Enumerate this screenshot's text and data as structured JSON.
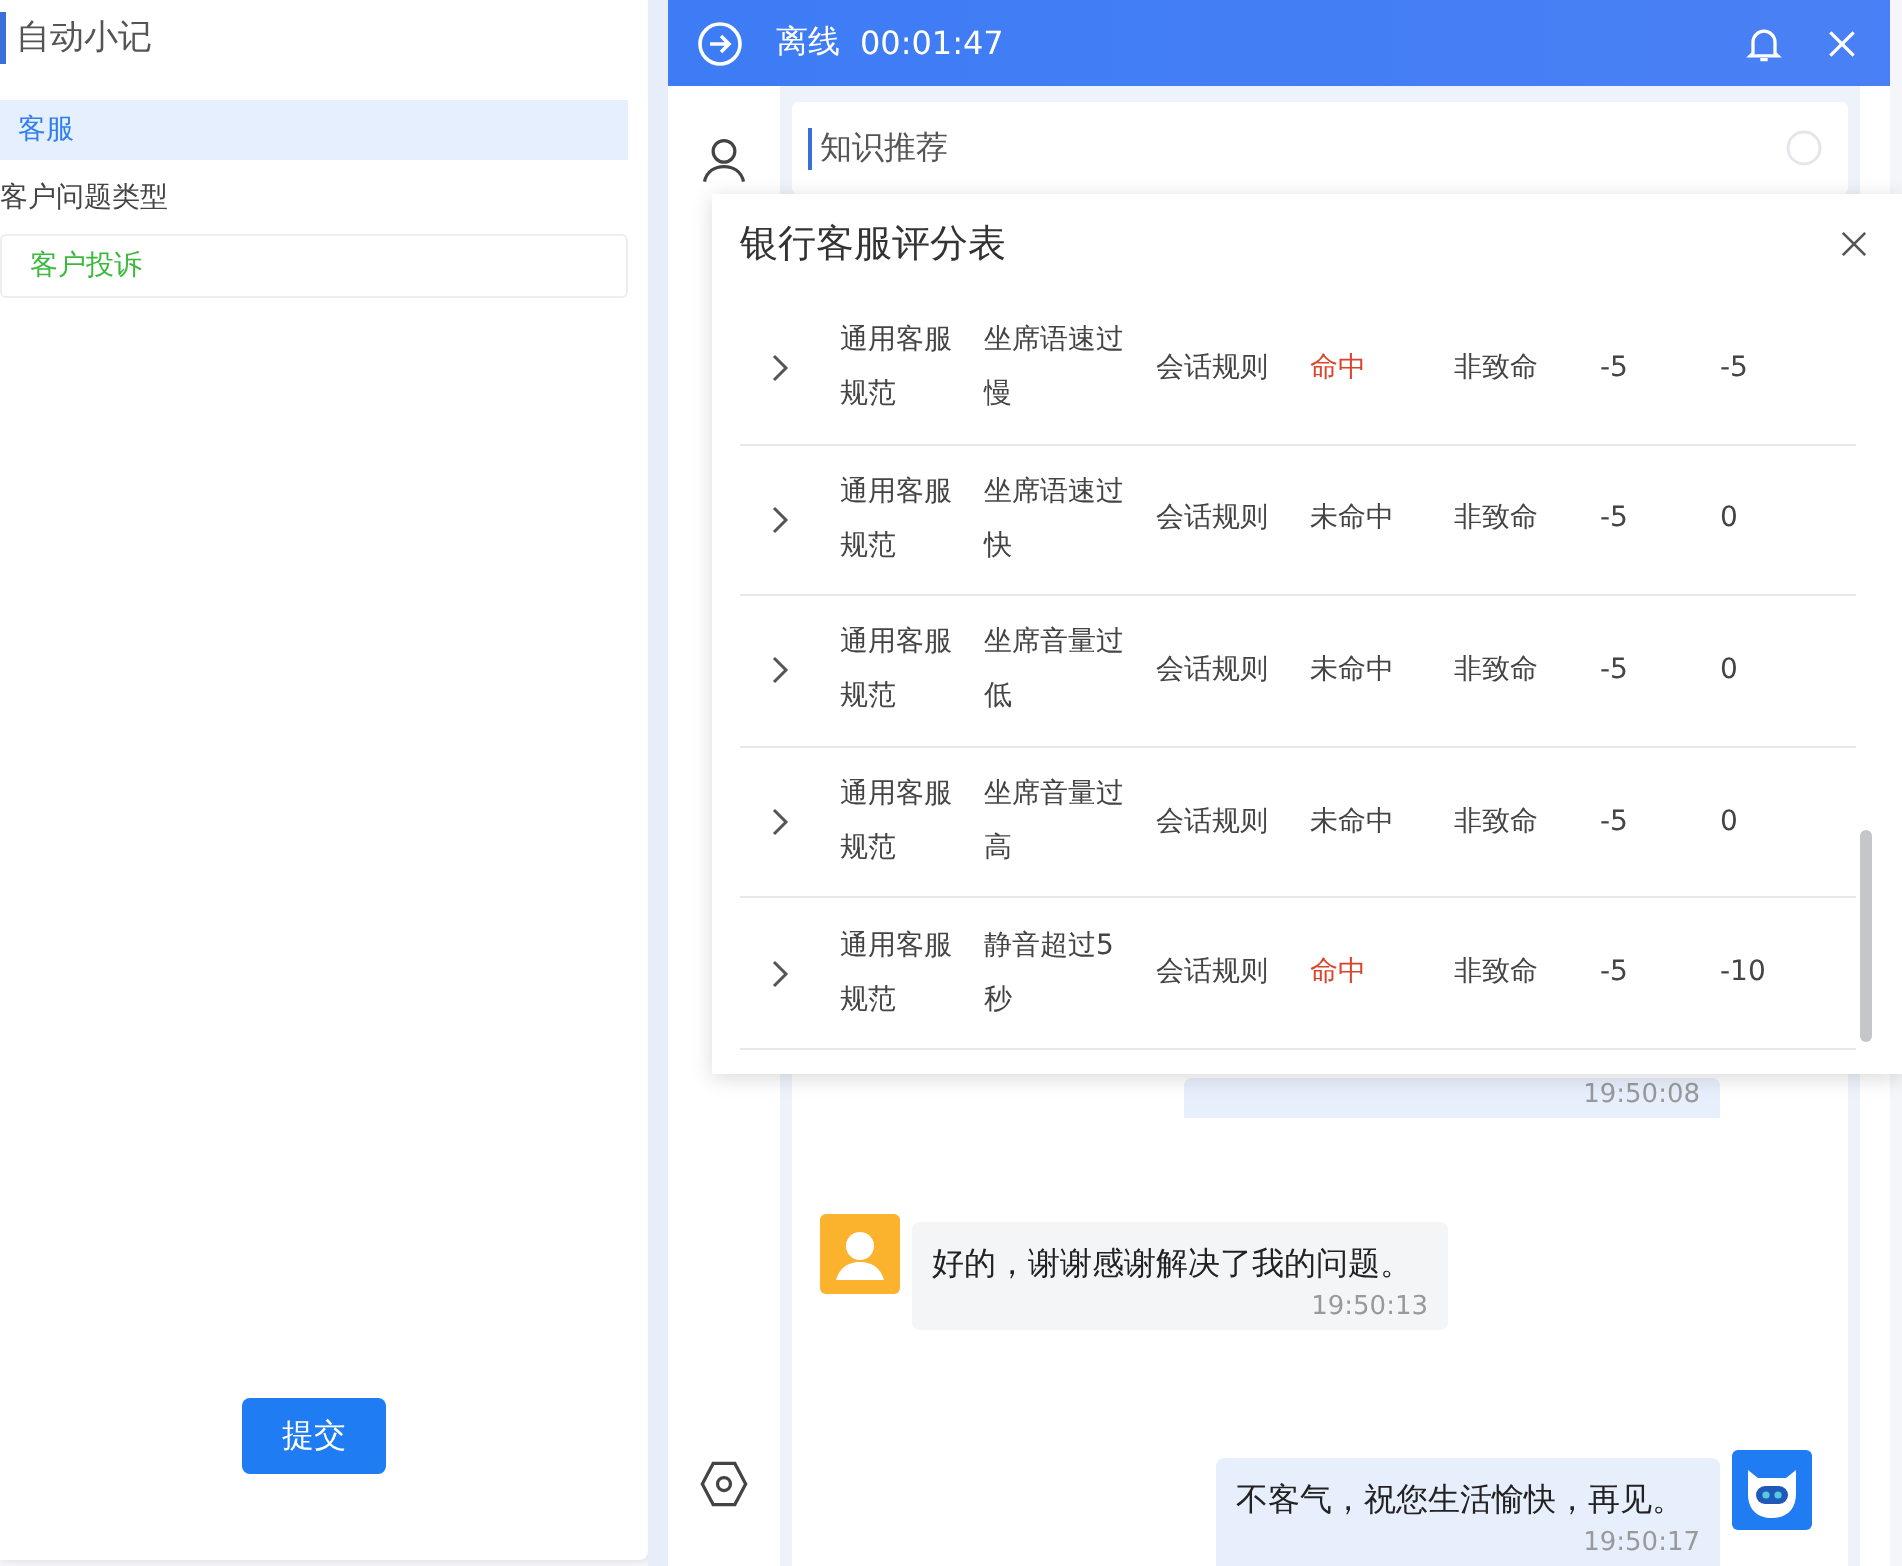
{
  "notes_panel": {
    "title": "自动小记",
    "items": [
      {
        "label": "客服",
        "selected": true
      }
    ],
    "field_label": "客户问题类型",
    "field_value": "客户投诉",
    "submit": "提交"
  },
  "window": {
    "status": "离线",
    "timer": "00:01:47"
  },
  "knowledge": {
    "title": "知识推荐"
  },
  "dialog": {
    "title": "银行客服评分表",
    "rows": [
      {
        "category": "通用客服规范",
        "rule": "坐席语速过慢",
        "type": "会话规则",
        "result": "命中",
        "hit": true,
        "severity": "非致命",
        "deduction": "-5",
        "score": "-5"
      },
      {
        "category": "通用客服规范",
        "rule": "坐席语速过快",
        "type": "会话规则",
        "result": "未命中",
        "hit": false,
        "severity": "非致命",
        "deduction": "-5",
        "score": "0"
      },
      {
        "category": "通用客服规范",
        "rule": "坐席音量过低",
        "type": "会话规则",
        "result": "未命中",
        "hit": false,
        "severity": "非致命",
        "deduction": "-5",
        "score": "0"
      },
      {
        "category": "通用客服规范",
        "rule": "坐席音量过高",
        "type": "会话规则",
        "result": "未命中",
        "hit": false,
        "severity": "非致命",
        "deduction": "-5",
        "score": "0"
      },
      {
        "category": "通用客服规范",
        "rule": "静音超过5秒",
        "type": "会话规则",
        "result": "命中",
        "hit": true,
        "severity": "非致命",
        "deduction": "-5",
        "score": "-10"
      }
    ]
  },
  "chat": [
    {
      "kind": "agent",
      "time": "19:50:08"
    },
    {
      "kind": "customer",
      "text": "好的，谢谢感谢解决了我的问题。",
      "time": "19:50:13"
    },
    {
      "kind": "agent",
      "text": "不客气，祝您生活愉快，再见。",
      "time": "19:50:17"
    }
  ]
}
